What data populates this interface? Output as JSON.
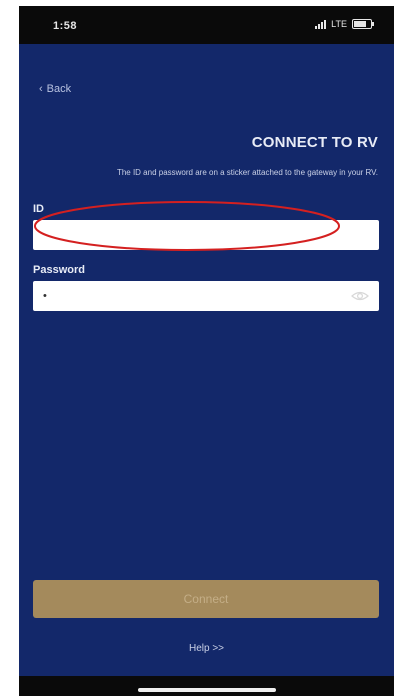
{
  "status_bar": {
    "time": "1:58",
    "network": "LTE"
  },
  "nav": {
    "back_label": "Back"
  },
  "header": {
    "title": "CONNECT TO RV",
    "subtitle": "The ID and password are on a sticker attached to the gateway in your RV."
  },
  "form": {
    "id_label": "ID",
    "id_value": "",
    "password_label": "Password",
    "password_value": "a"
  },
  "actions": {
    "connect_label": "Connect",
    "help_label": "Help >>"
  },
  "colors": {
    "background": "#13286a",
    "button": "#a48a5c",
    "highlight_ellipse": "#d42020"
  }
}
